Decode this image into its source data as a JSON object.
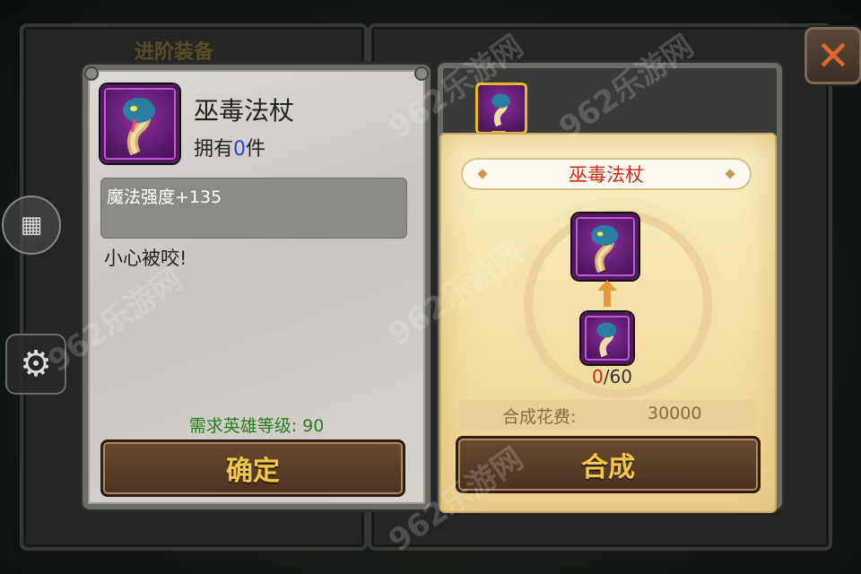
{
  "background": {
    "title": "进阶装备"
  },
  "item": {
    "name": "巫毒法杖",
    "owned_prefix": "拥有",
    "owned_count": "0",
    "owned_suffix": "件",
    "stat": "魔法强度+135",
    "flavor": "小心被咬!",
    "required_level": "需求英雄等级: 90",
    "icon": "cobra-icon"
  },
  "buttons": {
    "confirm": "确定",
    "synthesize": "合成",
    "close_icon": "close-icon",
    "settings_icon": "gear-icon",
    "menu_icon": "grid-icon"
  },
  "synthesis": {
    "title": "巫毒法杖",
    "fragment_current": "0",
    "fragment_total": "/60",
    "cost_label": "合成花费:",
    "cost_value": "30000"
  },
  "watermark": {
    "text": "962乐游网"
  },
  "colors": {
    "accent_gold": "#f2c74a",
    "title_red": "#d12a1a",
    "level_green": "#2c7a24",
    "owned_blue": "#2244dd"
  }
}
